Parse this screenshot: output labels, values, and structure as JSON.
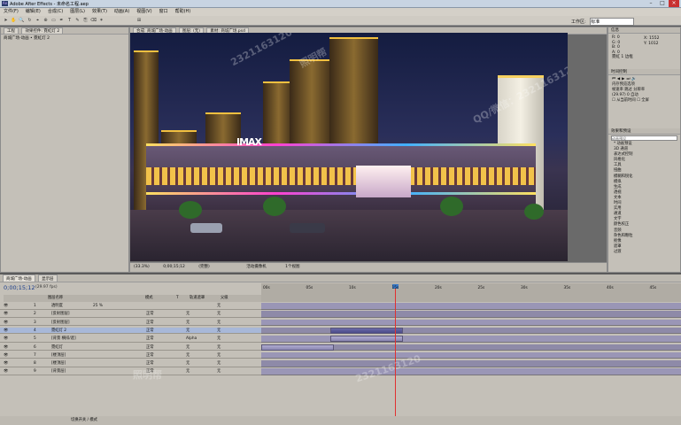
{
  "window": {
    "title": "Adobe After Effects - 未命名工程.aep",
    "app_icon": "Ae"
  },
  "menu": [
    "文件(F)",
    "编辑(E)",
    "合成(C)",
    "图层(L)",
    "效果(T)",
    "动画(A)",
    "视图(V)",
    "窗口",
    "帮助(H)"
  ],
  "workspace": {
    "label": "工作区:",
    "value": "标准"
  },
  "project_panel": {
    "tabs": [
      "工程",
      "效果控件: 霓虹灯 2"
    ],
    "subtitle": "商城广场-动画 • 霓虹灯 2"
  },
  "comp_panel": {
    "tabs": [
      "合成: 商城广场-动画",
      "图层: (无)",
      "素材: 商城广场.psd"
    ],
    "footer": [
      "(33.3%)",
      "0;00;15;12",
      "(完整)",
      "活动摄像机",
      "1个视图"
    ]
  },
  "info_panel": {
    "lines": [
      "R: 0",
      "G: 0",
      "B: 0",
      "A: 0",
      "X: 1552",
      "Y: 1012"
    ],
    "note": "霓虹 1 边框"
  },
  "preview_panel": {
    "title": "时间控制",
    "labels": [
      "内存预览选项",
      "帧速率",
      "跳过",
      "分辨率"
    ],
    "values": [
      "(29.97)",
      "0",
      "自动"
    ],
    "checks": [
      "从当前时间",
      "全屏"
    ]
  },
  "effects_panel": {
    "title": "效果和预设",
    "search_placeholder": "动画预设",
    "items": [
      "* 动画预设",
      "3D 通道",
      "表达式控制",
      "风格化",
      "工具",
      "扭曲",
      "模糊和锐化",
      "模拟",
      "生成",
      "透视",
      "文本",
      "时间",
      "实用",
      "通道",
      "文字",
      "颜色校正",
      "音频",
      "杂色和颗粒",
      "抠像",
      "遮罩",
      "过渡"
    ]
  },
  "timeline": {
    "tabs": [
      "商城广场-动画",
      "显示层"
    ],
    "timecode": "0;00;15;12",
    "fps": "(29.97 fps)",
    "columns": [
      "图层名称",
      "模式",
      "T",
      "轨道遮罩",
      "父级"
    ],
    "ruler": [
      "00s",
      "05s",
      "10s",
      "15s",
      "20s",
      "25s",
      "30s",
      "35s",
      "40s",
      "45s"
    ],
    "layers": [
      {
        "num": "1",
        "name": "透明度",
        "mode": "",
        "parent": "无",
        "sub": "25 %"
      },
      {
        "num": "2",
        "name": "[反射图层]",
        "mode": "正常",
        "matte": "无",
        "parent": "无"
      },
      {
        "num": "3",
        "name": "[反射图层]",
        "mode": "正常",
        "matte": "无",
        "parent": "无"
      },
      {
        "num": "4",
        "name": "霓虹灯 2",
        "mode": "正常",
        "matte": "无",
        "parent": "无"
      },
      {
        "num": "5",
        "name": "[背景 横排/遮]",
        "mode": "正常",
        "matte": "Alpha",
        "parent": "无"
      },
      {
        "num": "6",
        "name": "霓虹灯",
        "mode": "正常",
        "matte": "无",
        "parent": "无"
      },
      {
        "num": "7",
        "name": "[楼顶层]",
        "mode": "正常",
        "matte": "无",
        "parent": "无"
      },
      {
        "num": "8",
        "name": "[楼顶层]",
        "mode": "正常",
        "matte": "无",
        "parent": "无"
      },
      {
        "num": "9",
        "name": "[背景层]",
        "mode": "正常",
        "matte": "无",
        "parent": "无"
      }
    ],
    "footer": "切换开关 / 模式"
  },
  "watermark": [
    "照明帮",
    "QQ/微信：2321163120",
    "2321163120"
  ],
  "colors": {
    "playhead": "#e03030",
    "selection": "#3a5a9a",
    "layer_bar": "#9a96c2"
  }
}
